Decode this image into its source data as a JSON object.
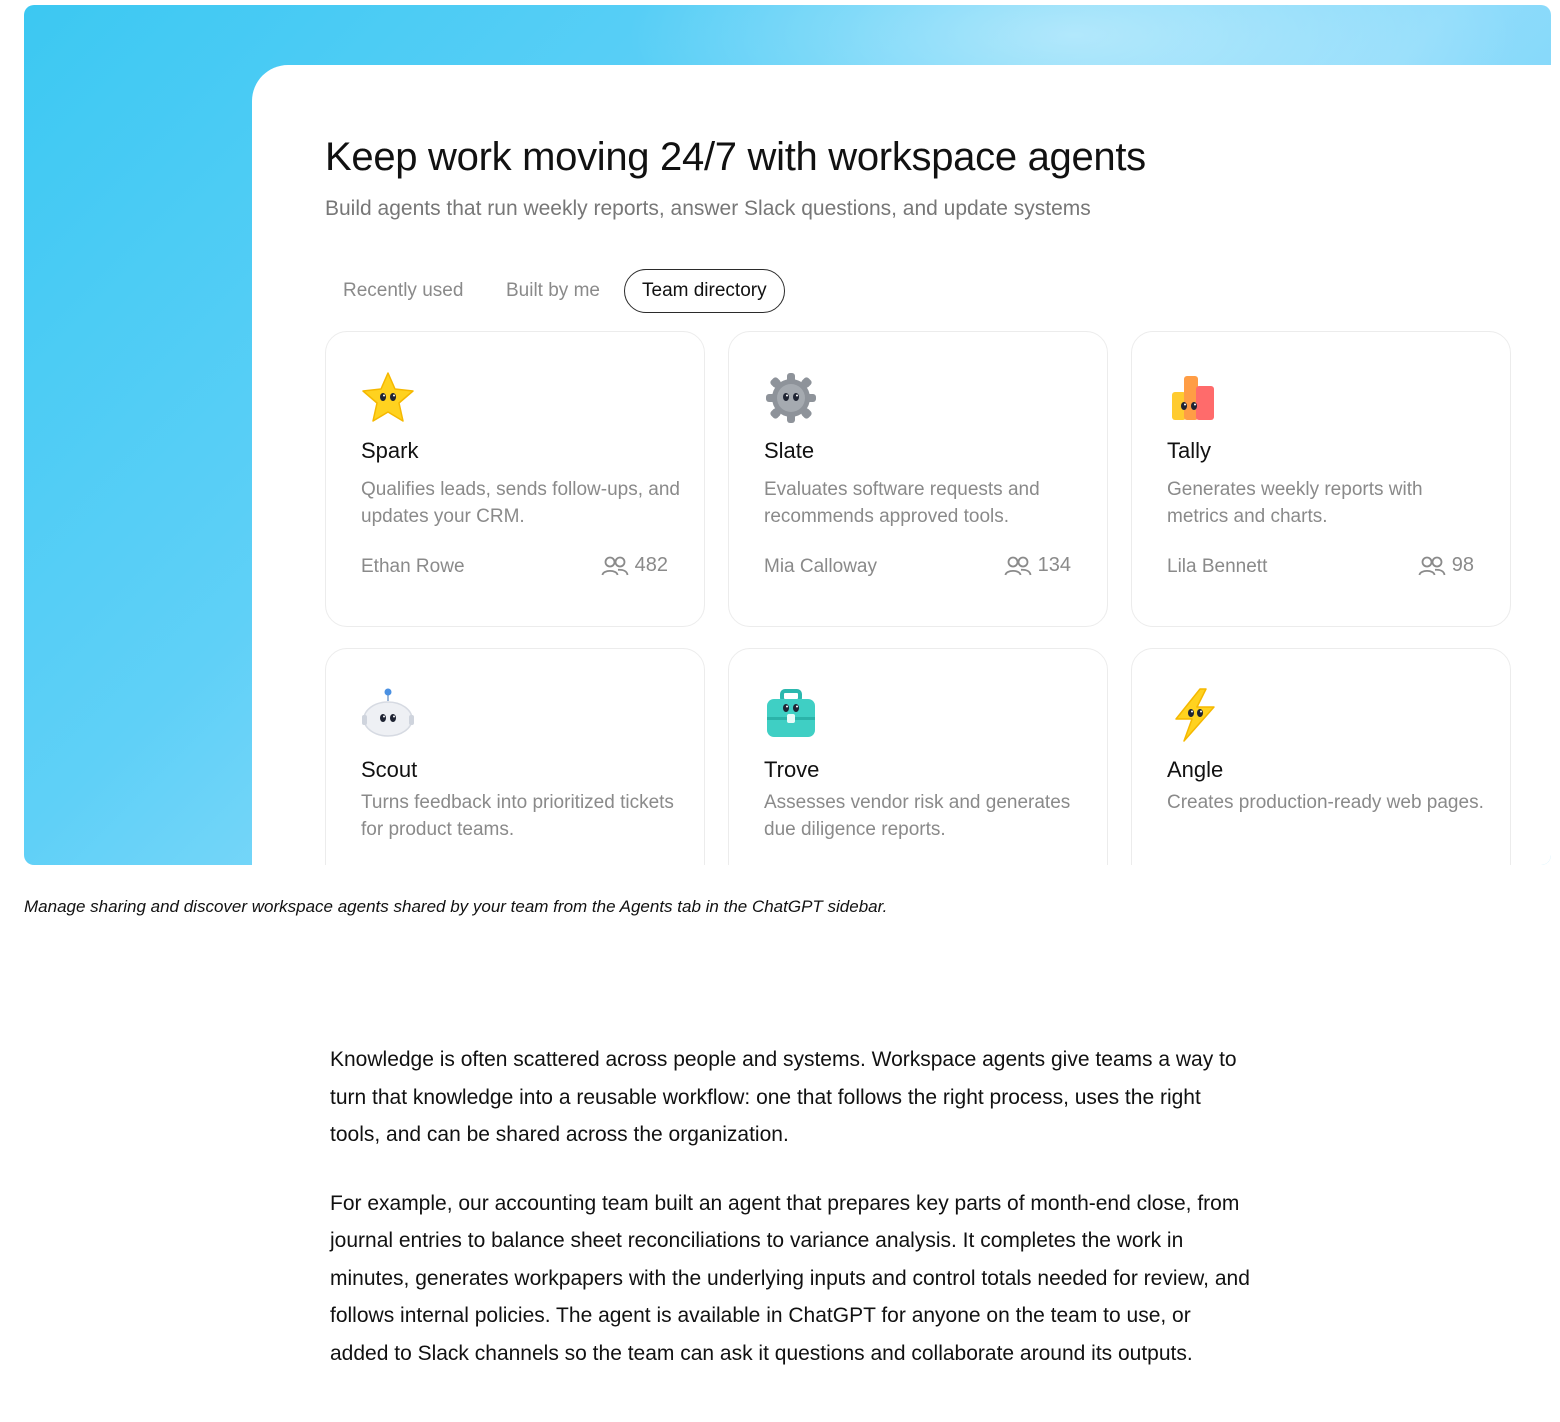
{
  "hero": {
    "title": "Keep work moving 24/7 with workspace agents",
    "subtitle": "Build agents that run weekly reports, answer Slack questions, and update systems",
    "tabs": [
      {
        "label": "Recently used",
        "selected": false
      },
      {
        "label": "Built by me",
        "selected": false
      },
      {
        "label": "Team directory",
        "selected": true
      }
    ],
    "agents": [
      {
        "name": "Spark",
        "description": "Qualifies leads, sends follow-ups, and updates your CRM.",
        "author": "Ethan Rowe",
        "users": "482",
        "icon": "star-face-icon"
      },
      {
        "name": "Slate",
        "description": "Evaluates software requests and recommends approved tools.",
        "author": "Mia Calloway",
        "users": "134",
        "icon": "gear-face-icon"
      },
      {
        "name": "Tally",
        "description": "Generates weekly reports with metrics and charts.",
        "author": "Lila Bennett",
        "users": "98",
        "icon": "bar-chart-face-icon"
      },
      {
        "name": "Scout",
        "description": "Turns feedback into prioritized tickets for product teams.",
        "icon": "robot-face-icon"
      },
      {
        "name": "Trove",
        "description": "Assesses vendor risk and generates due diligence reports.",
        "icon": "briefcase-face-icon"
      },
      {
        "name": "Angle",
        "description": "Creates production-ready web pages.",
        "icon": "lightning-face-icon"
      }
    ]
  },
  "caption": "Manage sharing and discover workspace agents shared by your team from the Agents tab in the ChatGPT sidebar.",
  "body": {
    "paragraphs": [
      "Knowledge is often scattered across people and systems. Workspace agents give teams a way to turn that knowledge into a reusable workflow: one that follows the right process, uses the right tools, and can be shared across the organization.",
      "For example, our accounting team built an agent that prepares key parts of month-end close, from journal entries to balance sheet reconciliations to variance analysis. It completes the work in minutes, generates workpapers with the underlying inputs and control totals needed for review, and follows internal policies. The agent is available in ChatGPT for anyone on the team to use, or added to Slack channels so the team can ask it questions and collaborate around its outputs."
    ]
  }
}
